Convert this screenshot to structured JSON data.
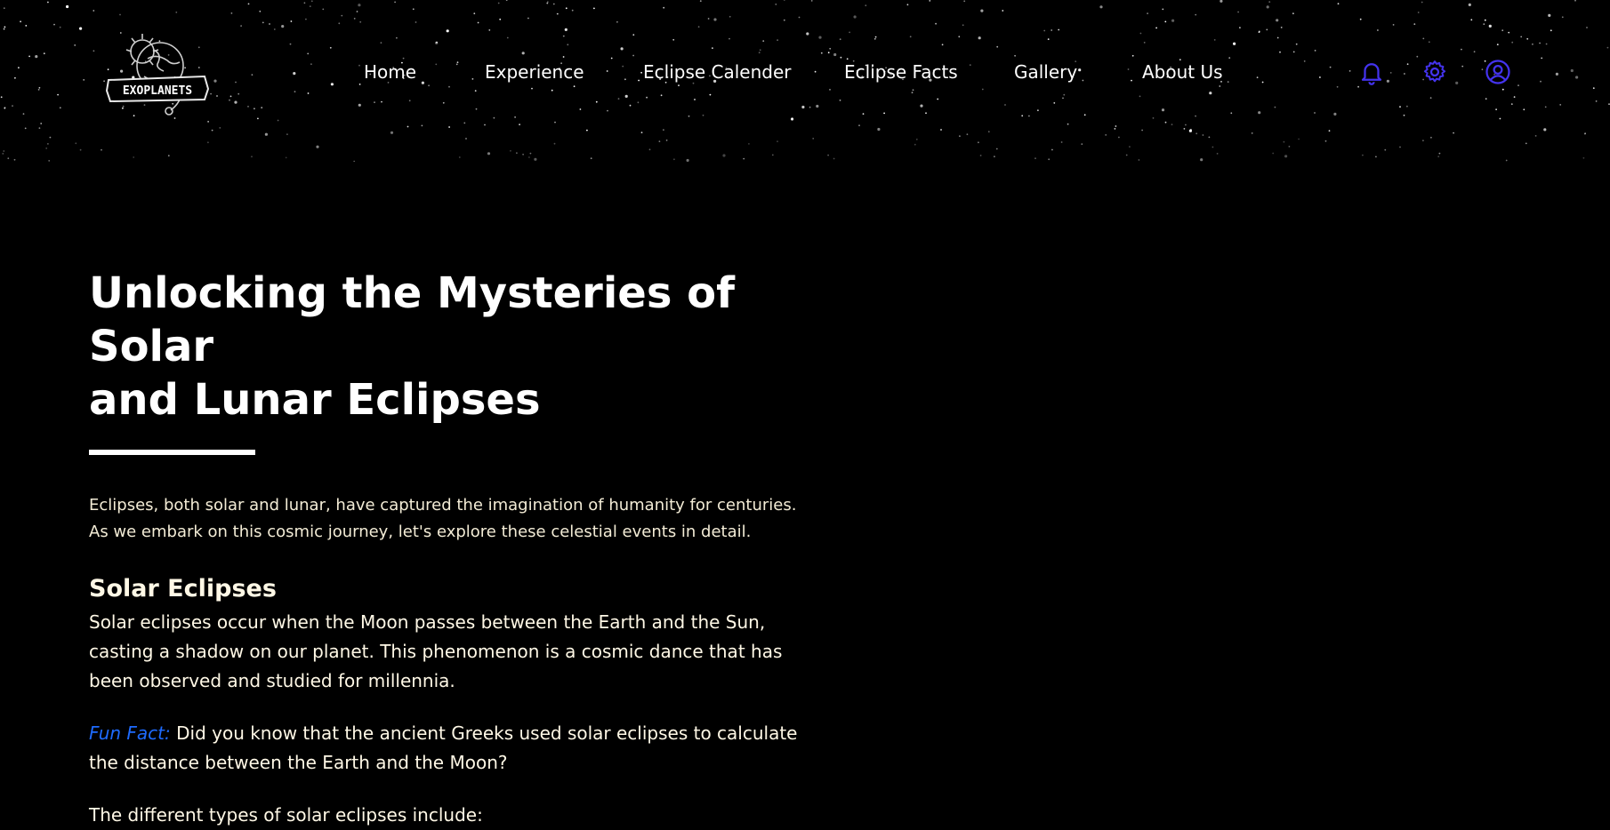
{
  "header": {
    "logo_text": "EXOPLANETS",
    "nav": [
      {
        "label": "Home",
        "name": "nav-home"
      },
      {
        "label": "Experience",
        "name": "nav-experience"
      },
      {
        "label": "Eclipse Calender",
        "name": "nav-eclipse-calender"
      },
      {
        "label": "Eclipse Facts",
        "name": "nav-eclipse-facts"
      },
      {
        "label": "Gallery",
        "name": "nav-gallery"
      },
      {
        "label": "About Us",
        "name": "nav-about-us"
      }
    ],
    "icons": [
      "bell-icon",
      "gear-icon",
      "user-circle-icon"
    ],
    "icon_color": "#4433ee"
  },
  "main": {
    "title_line1": "Unlocking the Mysteries of Solar",
    "title_line2": "and Lunar Eclipses",
    "intro_line1": "Eclipses, both solar and lunar, have captured the imagination of humanity for centuries.",
    "intro_line2": "As we embark on this cosmic journey, let's explore these celestial events in detail.",
    "solar_heading": "Solar Eclipses",
    "solar_text": "Solar eclipses occur when the Moon passes between the Earth and the Sun, casting a shadow on our planet. This phenomenon is a cosmic dance that has been observed and studied for millennia.",
    "fun_fact_label": "Fun Fact:",
    "fun_fact_text": " Did you know that the ancient Greeks used solar eclipses to calculate the distance between the Earth and the Moon?",
    "types_intro": "The different types of solar eclipses include:"
  },
  "colors": {
    "background": "#000000",
    "text_cream": "#fff8e6",
    "fun_fact_blue": "#1e6bff",
    "icon_blue": "#4433ee"
  }
}
